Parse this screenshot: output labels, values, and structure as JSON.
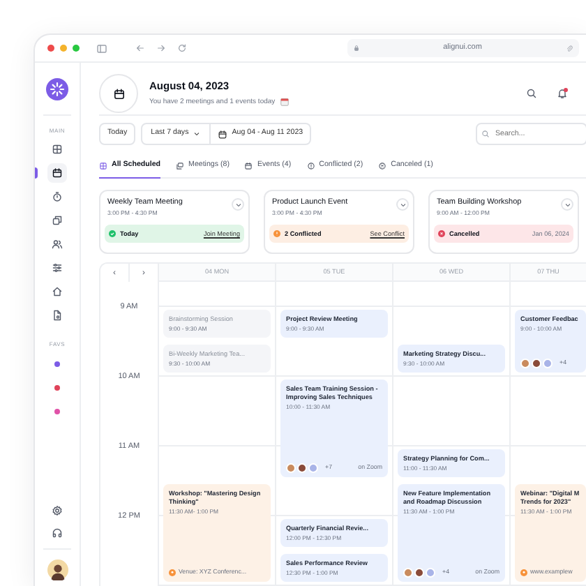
{
  "browser": {
    "url": "alignui.com"
  },
  "sidebar": {
    "main_label": "MAIN",
    "main_items": [
      {
        "selected": false
      },
      {
        "selected": true
      },
      {
        "selected": false
      },
      {
        "selected": false
      },
      {
        "selected": false
      },
      {
        "selected": false
      },
      {
        "selected": false
      },
      {
        "selected": false
      }
    ],
    "favs_label": "FAVS",
    "favs": [
      {
        "color": "#7c5ce6"
      },
      {
        "color": "#e0435a"
      },
      {
        "color": "#e052a8"
      }
    ]
  },
  "header": {
    "title": "August 04, 2023",
    "subtitle": "You have 2 meetings and 1 events today"
  },
  "toolbar": {
    "today": "Today",
    "range": "Last 7 days",
    "dates": "Aug 04 - Aug 11 2023",
    "search": {
      "placeholder": "Search..."
    }
  },
  "tabs": [
    {
      "label": "All Scheduled",
      "selected": true
    },
    {
      "label": "Meetings (8)",
      "selected": false
    },
    {
      "label": "Events (4)",
      "selected": false
    },
    {
      "label": "Conflicted (2)",
      "selected": false
    },
    {
      "label": "Canceled (1)",
      "selected": false
    }
  ],
  "cards": [
    {
      "title": "Weekly Team Meeting",
      "time": "3:00 PM - 4:30 PM",
      "status": {
        "kind": "today",
        "label": "Today",
        "link": "Join Meeting"
      }
    },
    {
      "title": "Product Launch Event",
      "time": "3:00 PM - 4:30 PM",
      "status": {
        "kind": "conflict",
        "label": "2 Conflicted",
        "link": "See Conflict"
      }
    },
    {
      "title": "Team Building Workshop",
      "time": "9:00 AM - 12:00 PM",
      "status": {
        "kind": "cancelled",
        "label": "Cancelled",
        "note": "Jan 06, 2024"
      }
    }
  ],
  "calendar": {
    "prev": "‹",
    "next": "›",
    "hours": [
      "9 AM",
      "10 AM",
      "11 AM",
      "12 PM"
    ],
    "days": [
      {
        "label": "04 MON",
        "events": [
          {
            "kind": "past",
            "title": "Brainstorming Session",
            "time": "9:00 - 9:30 AM"
          },
          {
            "kind": "past",
            "title": "Bi-Weekly Marketing Tea...",
            "time": "9:30 - 10:00 AM"
          },
          {
            "kind": "event",
            "title": "Workshop: \"Mastering Design Thinking\"",
            "time": "11:30 AM- 1:00 PM",
            "venue": "Venue: XYZ Conferenc..."
          }
        ]
      },
      {
        "label": "05 TUE",
        "events": [
          {
            "kind": "meeting",
            "title": "Project Review Meeting",
            "time": "9:00 - 9:30 AM"
          },
          {
            "kind": "meeting",
            "title": "Sales Team Training Session - Improving Sales Techniques",
            "time": "10:00 - 11:30 AM",
            "extra": "+7",
            "location": "on Zoom"
          },
          {
            "kind": "meeting",
            "title": "Quarterly Financial Revie...",
            "time": "12:00 PM - 12:30 PM"
          },
          {
            "kind": "meeting",
            "title": "Sales Performance Review",
            "time": "12:30 PM - 1:00 PM"
          }
        ]
      },
      {
        "label": "06 WED",
        "events": [
          {
            "kind": "meeting",
            "title": "Marketing Strategy Discu...",
            "time": "9:30 - 10:00 AM"
          },
          {
            "kind": "meeting",
            "title": "Strategy Planning for Com...",
            "time": "11:00 - 11:30 AM"
          },
          {
            "kind": "meeting",
            "title": "New Feature Implementation and Roadmap Discussion",
            "time": "11:30 AM - 1:00 PM",
            "extra": "+4",
            "location": "on Zoom"
          }
        ]
      },
      {
        "label": "07 THU",
        "events": [
          {
            "kind": "meeting",
            "title": "Customer Feedbac",
            "time": "9:00 - 10:00 AM",
            "extra": "+4"
          },
          {
            "kind": "event",
            "title": "Webinar: \"Digital M\nTrends for 2023\"",
            "time": "11:30 AM - 1:00 PM",
            "venue": "www.examplew"
          }
        ]
      }
    ]
  }
}
